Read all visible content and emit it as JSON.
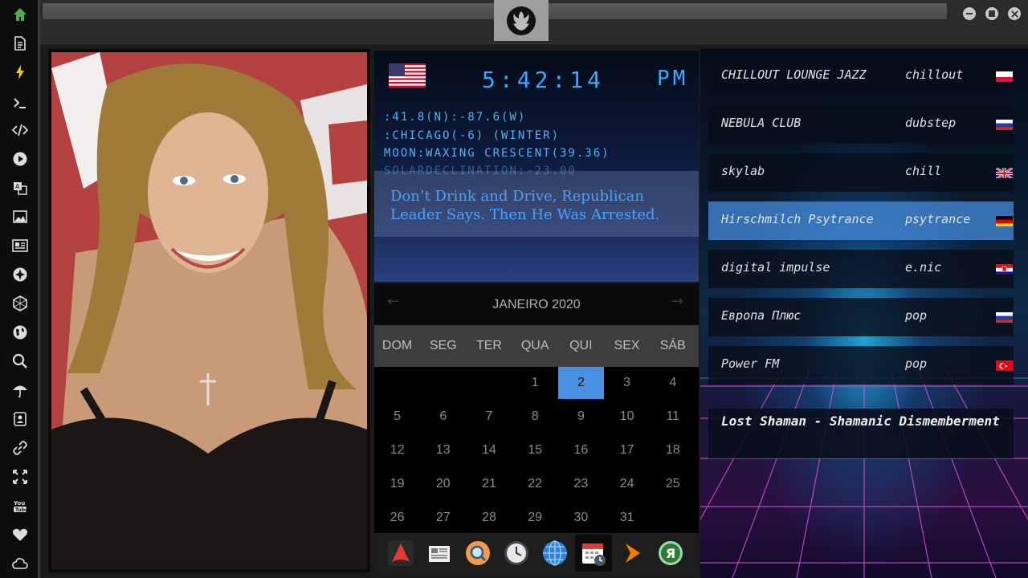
{
  "sidebar": {
    "icons": [
      "home-icon",
      "document-icon",
      "lightning-icon",
      "terminal-icon",
      "code-icon",
      "play-icon",
      "translate-icon",
      "image-icon",
      "news-icon",
      "rebel-icon",
      "hexagon-icon",
      "globe-icon",
      "search-icon",
      "umbrella-icon",
      "contacts-icon",
      "link-icon",
      "expand-icon",
      "youtube-icon",
      "heart-icon",
      "cloud-icon"
    ],
    "accent": "#4caf50"
  },
  "clock": {
    "time": "5:42:14",
    "ampm": "PM",
    "coords": ":41.8(N):-87.6(W)",
    "location": ":CHICAGO(-6) (WINTER)",
    "moon": "MOON:WAXING CRESCENT(39.36)",
    "solar": "SOLARDECLINATION:-23.00",
    "headline": "Don’t Drink and Drive, Republican Leader Says. Then He Was Arrested."
  },
  "calendar": {
    "title": "JANEIRO 2020",
    "days": [
      "DOM",
      "SEG",
      "TER",
      "QUA",
      "QUI",
      "SEX",
      "SÁB"
    ],
    "weeks": [
      [
        "",
        "",
        "",
        "1",
        "2",
        "3",
        "4"
      ],
      [
        "5",
        "6",
        "7",
        "8",
        "9",
        "10",
        "11"
      ],
      [
        "12",
        "13",
        "14",
        "15",
        "16",
        "17",
        "18"
      ],
      [
        "19",
        "20",
        "21",
        "22",
        "23",
        "24",
        "25"
      ],
      [
        "26",
        "27",
        "28",
        "29",
        "30",
        "31",
        ""
      ]
    ],
    "today": "2",
    "today_color": "#4a90e2"
  },
  "dock": {
    "items": [
      "arch-icon",
      "newspaper-icon",
      "search-app-icon",
      "clock-app-icon",
      "browser-globe-icon",
      "calendar-app-icon",
      "play-arrow-icon",
      "yandex-icon"
    ],
    "active": "calendar-app-icon"
  },
  "radio": {
    "stations": [
      {
        "name": "CHILLOUT LOUNGE JAZZ",
        "genre": "chillout",
        "flag": "poland"
      },
      {
        "name": "NEBULA CLUB",
        "genre": "dubstep",
        "flag": "russia"
      },
      {
        "name": "skylab",
        "genre": "chill",
        "flag": "uk"
      },
      {
        "name": "Hirschmilch Psytrance",
        "genre": "psytrance",
        "flag": "germany"
      },
      {
        "name": "digital impulse",
        "genre": "e.nic",
        "flag": "croatia"
      },
      {
        "name": "Европа Плюс",
        "genre": "pop",
        "flag": "russia"
      },
      {
        "name": "Power FM",
        "genre": "pop",
        "flag": "turkey"
      }
    ],
    "selected": "Hirschmilch Psytrance",
    "now_playing": "Lost Shaman - Shamanic Dismemberment"
  }
}
